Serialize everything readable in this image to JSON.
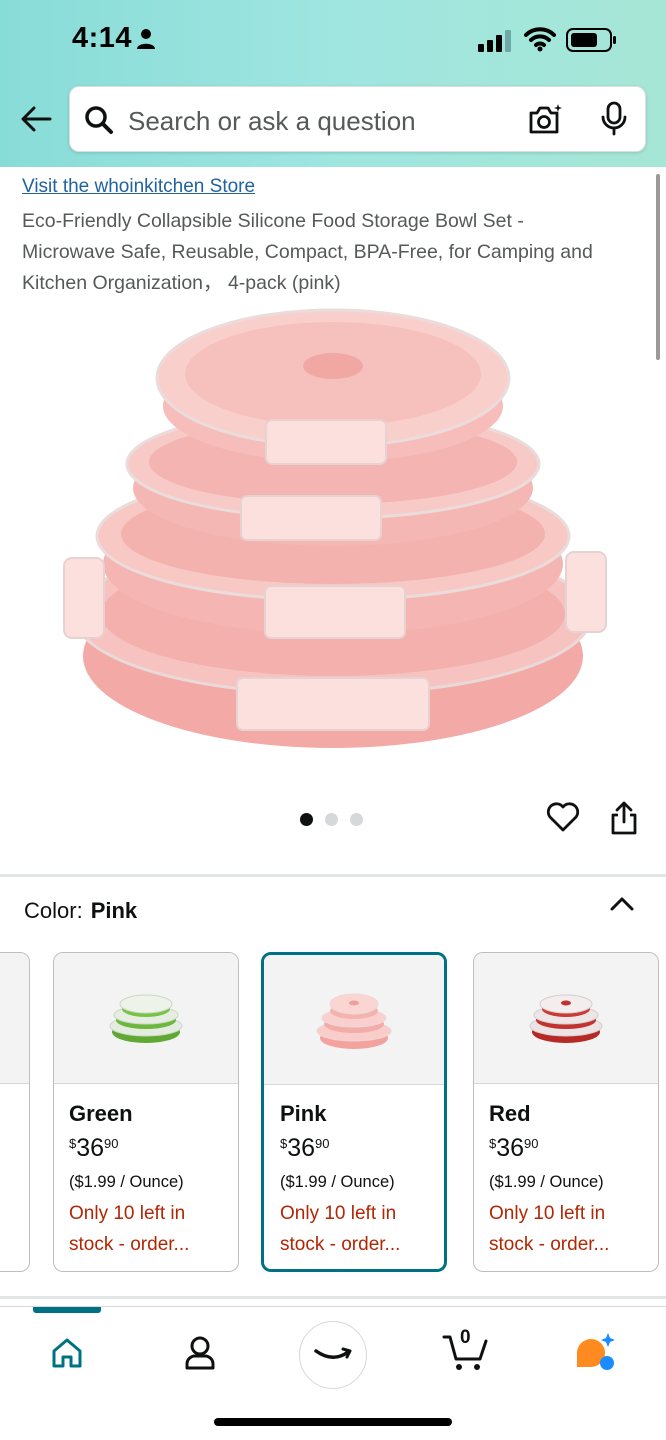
{
  "status_bar": {
    "time": "4:14"
  },
  "search": {
    "placeholder": "Search or ask a question"
  },
  "product": {
    "store_link": "Visit the whoinkitchen Store",
    "title": "Eco-Friendly Collapsible Silicone Food Storage Bowl Set - Microwave Safe, Reusable, Compact, BPA-Free, for Camping and Kitchen Organization， 4-pack (pink)",
    "image_count": 3,
    "active_image": 1
  },
  "color": {
    "label": "Color:",
    "selected": "Pink",
    "options": [
      {
        "name": "Green",
        "currency": "$",
        "price_whole": "36",
        "price_cents": "90",
        "unit_price": "($1.99 / Ounce)",
        "stock": "Only 10 left in stock - order...",
        "swatch": "#7cc24a",
        "selected": false
      },
      {
        "name": "Pink",
        "currency": "$",
        "price_whole": "36",
        "price_cents": "90",
        "unit_price": "($1.99 / Ounce)",
        "stock": "Only 10 left in stock - order...",
        "swatch": "#f4a4a0",
        "selected": true
      },
      {
        "name": "Red",
        "currency": "$",
        "price_whole": "36",
        "price_cents": "90",
        "unit_price": "($1.99 / Ounce)",
        "stock": "Only 10 left in stock - order...",
        "swatch": "#c9302c",
        "selected": false
      }
    ]
  },
  "bottom_nav": {
    "items": [
      "home-icon",
      "account-icon",
      "amazon-smile-icon",
      "cart-icon",
      "rufus-icon"
    ],
    "cart_count": "0",
    "active": "home"
  },
  "colors": {
    "accent": "#007185",
    "link": "#2162a1",
    "stock_warning": "#b12704",
    "header_start": "#88dcd8",
    "header_end": "#a6e6d6"
  }
}
